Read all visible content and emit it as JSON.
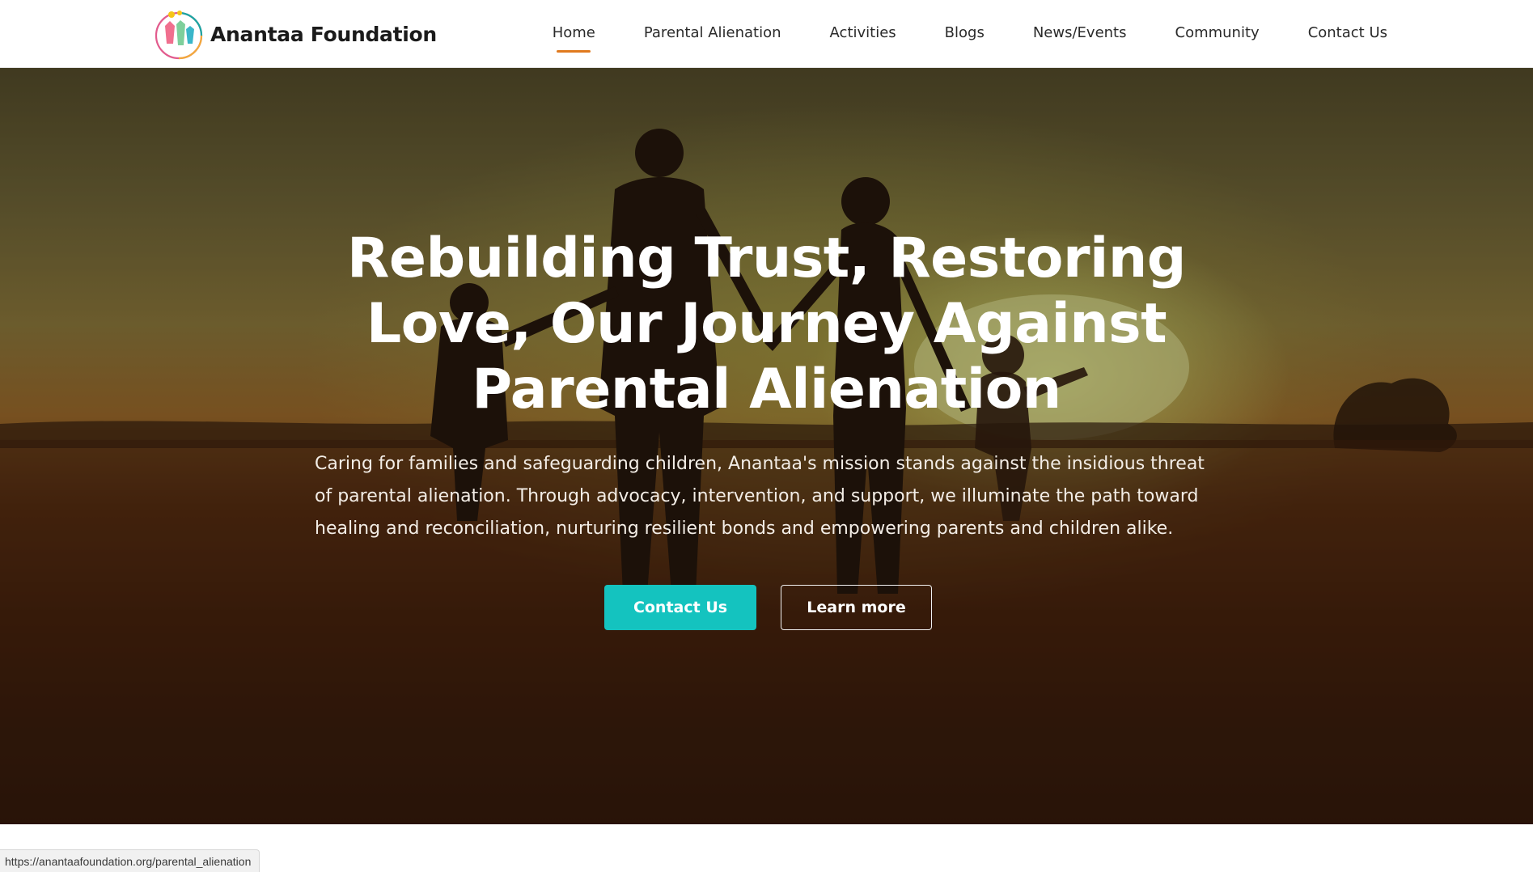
{
  "brand": {
    "name": "Anantaa Foundation"
  },
  "nav": {
    "items": [
      {
        "label": "Home",
        "active": true
      },
      {
        "label": "Parental Alienation",
        "active": false
      },
      {
        "label": "Activities",
        "active": false
      },
      {
        "label": "Blogs",
        "active": false
      },
      {
        "label": "News/Events",
        "active": false
      },
      {
        "label": "Community",
        "active": false
      },
      {
        "label": "Contact Us",
        "active": false
      }
    ]
  },
  "hero": {
    "title_lines": [
      "Rebuilding Trust, Restoring",
      "Love, Our Journey Against",
      "Parental Alienation"
    ],
    "description_lines": [
      "Caring for families and safeguarding children, Anantaa's mission stands against the insidious threat",
      "of parental alienation. Through advocacy, intervention, and support, we illuminate the path toward",
      "healing and reconciliation, nurturing resilient bonds and empowering parents and children alike."
    ],
    "primary_button": "Contact Us",
    "secondary_button": "Learn more"
  },
  "status_bar": {
    "url": "https://anantaafoundation.org/parental_alienation"
  },
  "colors": {
    "accent": "#e07a1f",
    "primary_button": "#14c3bf"
  }
}
